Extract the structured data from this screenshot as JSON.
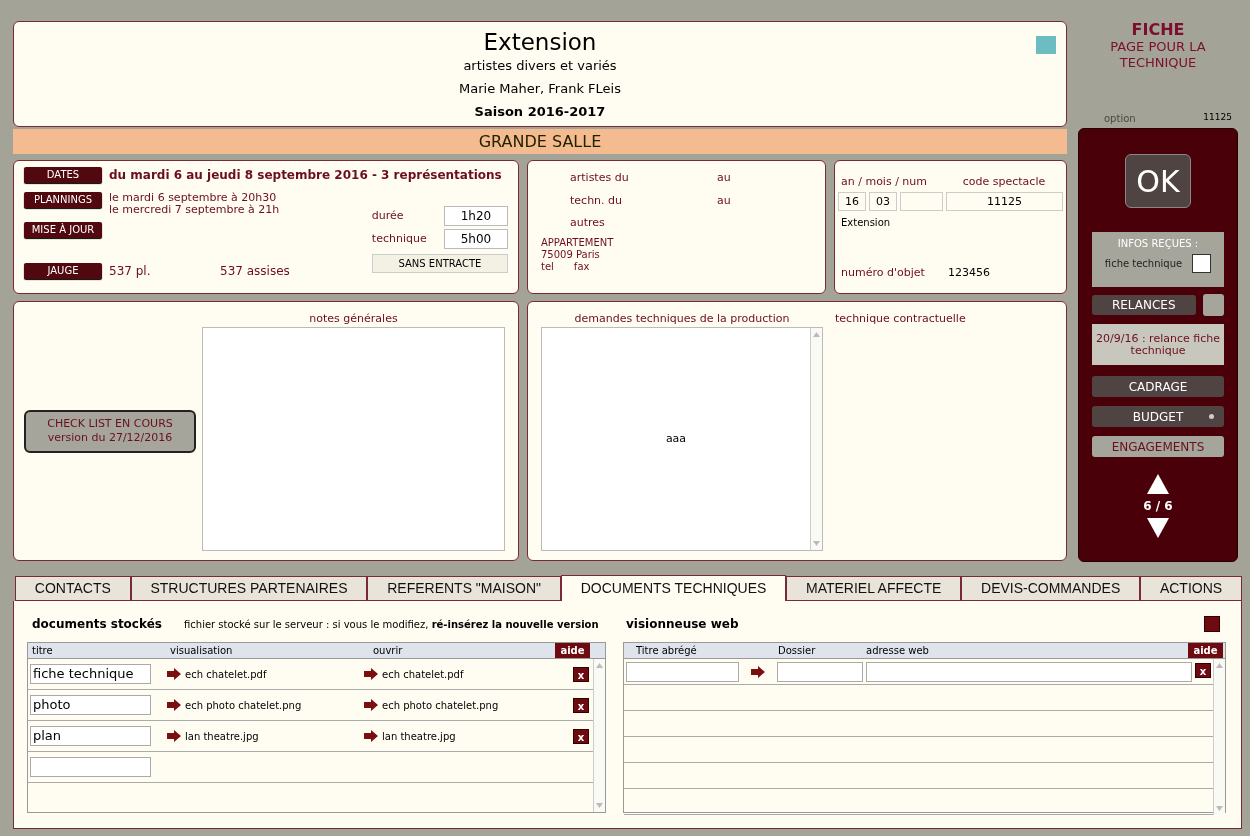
{
  "header": {
    "title": "Extension",
    "subtitle": "artistes divers et variés",
    "artists": "Marie Maher, Frank FLeis",
    "season": "Saison 2016-2017"
  },
  "hall": "GRANDE SALLE",
  "sheet": {
    "title": "FICHE",
    "subtitle": "PAGE POUR LA TECHNIQUE",
    "option": "option",
    "code": "11125"
  },
  "dates": {
    "buttons": [
      "DATES",
      "PLANNINGS",
      "MISE À JOUR",
      "JAUGE"
    ],
    "summary": "du mardi 6 au jeudi 8 septembre 2016 - 3 représentations",
    "plannings": [
      "le mardi 6 septembre à 20h30",
      "le mercredi 7 septembre à 21h"
    ],
    "capacity": "537 pl.",
    "seated": "537 assises",
    "duration_label": "durée",
    "duration": "1h20",
    "technique_label": "technique",
    "technique": "5h00",
    "intermission": "SANS ENTRACTE"
  },
  "presence": {
    "artists_label": "artistes du",
    "artists_to": "au",
    "techn_label": "techn. du",
    "techn_to": "au",
    "others_label": "autres",
    "address": [
      "APPARTEMENT",
      "75009 Paris"
    ],
    "tel": "tel",
    "fax": "fax"
  },
  "codes": {
    "date_label": "an / mois / num",
    "code_label": "code spectacle",
    "year": "16",
    "month": "03",
    "code": "11125",
    "name": "Extension",
    "object_label": "numéro d'objet",
    "object": "123456"
  },
  "notes": {
    "checklist": [
      "CHECK LIST EN COURS",
      "version du 27/12/2016"
    ],
    "general_label": "notes générales",
    "requests_label": "demandes techniques de la production",
    "requests": "aaa",
    "contract_label": "technique contractuelle"
  },
  "side": {
    "ok": "OK",
    "infos_label": "INFOS REÇUES :",
    "infos_item": "fiche technique",
    "infos_checked": false,
    "relances": "RELANCES",
    "relance_note": "20/9/16 : relance fiche technique",
    "buttons": [
      {
        "label": "CADRAGE",
        "kind": "dark"
      },
      {
        "label": "BUDGET",
        "kind": "flagged"
      },
      {
        "label": "ENGAGEMENTS",
        "kind": "light"
      }
    ],
    "pager": "6 / 6"
  },
  "tabs": [
    {
      "label": "CONTACTS",
      "selected": false
    },
    {
      "label": "STRUCTURES PARTENAIRES",
      "selected": false
    },
    {
      "label": "REFERENTS \"MAISON\"",
      "selected": false
    },
    {
      "label": "DOCUMENTS TECHNIQUES",
      "selected": true
    },
    {
      "label": "MATERIEL AFFECTE",
      "selected": false
    },
    {
      "label": "DEVIS-COMMANDES",
      "selected": false
    },
    {
      "label": "ACTIONS",
      "selected": false
    }
  ],
  "documents": {
    "title": "documents stockés",
    "notice": "fichier stocké sur le serveur : si vous le modifiez, **ré-insérez la nouvelle version**",
    "columns": [
      "titre",
      "visualisation",
      "ouvrir"
    ],
    "help": "aide",
    "rows": [
      {
        "kind": "file",
        "title": "fiche technique",
        "preview": "ech chatelet.pdf",
        "open": "ech chatelet.pdf",
        "delete": "x"
      },
      {
        "kind": "file",
        "title": "photo",
        "preview": "ech photo chatelet.png",
        "open": "ech photo chatelet.png",
        "delete": "x"
      },
      {
        "kind": "file",
        "title": "plan",
        "preview": "lan theatre.jpg",
        "open": "lan theatre.jpg",
        "delete": "x"
      },
      {
        "kind": "blank"
      }
    ]
  },
  "web": {
    "title": "visionneuse web",
    "columns": [
      "Titre abrégé",
      "Dossier",
      "adresse web"
    ],
    "help": "aide",
    "rows": [
      {
        "kind": "entry",
        "delete": "x"
      },
      {
        "kind": "empty"
      },
      {
        "kind": "empty"
      },
      {
        "kind": "empty"
      },
      {
        "kind": "empty"
      },
      {
        "kind": "empty"
      }
    ]
  }
}
